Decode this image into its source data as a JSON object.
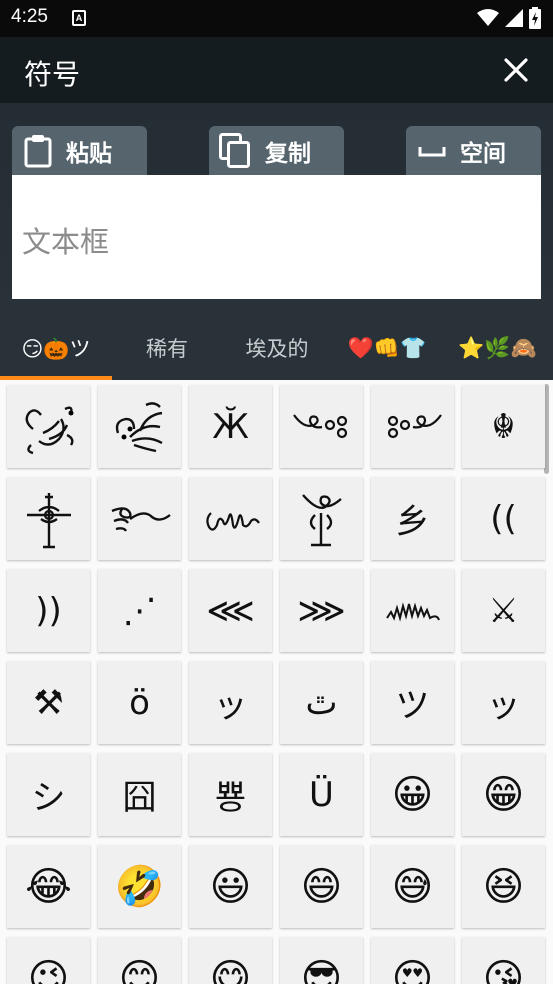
{
  "status_bar": {
    "time": "4:25",
    "notification_letter": "A"
  },
  "title_bar": {
    "title": "符号"
  },
  "actions": {
    "paste_label": "粘贴",
    "copy_label": "复制",
    "space_label": "空间",
    "textbox_placeholder": "文本框"
  },
  "categories": [
    {
      "label": "😏🎃ツ",
      "active": true
    },
    {
      "label": "稀有",
      "active": false
    },
    {
      "label": "埃及的",
      "active": false
    },
    {
      "label": "❤️👊👕",
      "active": false
    },
    {
      "label": "⭐🌿🙈",
      "active": false
    }
  ],
  "symbols": [
    "",
    "",
    "Ӂ",
    "",
    "",
    "☬",
    "",
    "",
    "",
    "",
    "乡",
    "((",
    "))",
    "⋰",
    "⋘",
    "⋙",
    "",
    "⚔",
    "⚒",
    "ӧ",
    "ッ",
    "ٿ",
    "ツ",
    "ッ",
    "シ",
    "囧",
    "뿅",
    "Ü",
    "😀",
    "😁",
    "😂",
    "🤣",
    "😃",
    "😄",
    "😅",
    "😆",
    "😉",
    "😊",
    "😋",
    "😎",
    "😍",
    "😘"
  ],
  "colors": {
    "accent": "#ff8a18",
    "tab_button": "#55646d",
    "title_bg": "#151c20"
  }
}
